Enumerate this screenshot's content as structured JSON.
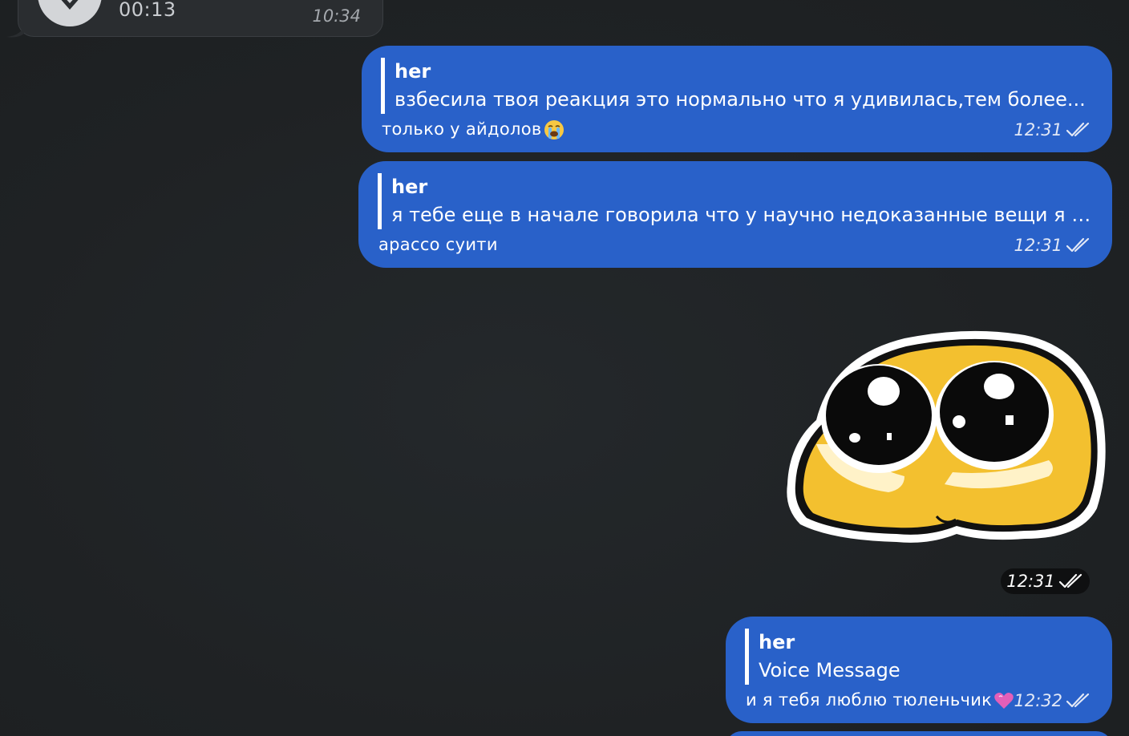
{
  "incoming_voice": {
    "duration": "00:13",
    "time": "10:34",
    "icon": "heart-icon"
  },
  "messages": [
    {
      "reply_author": "her",
      "reply_text": "взбесила твоя реакция   это нормально что я удивилась,тем более...",
      "text": "только у айдолов",
      "emoji": "loudly-crying-face-icon",
      "time": "12:31",
      "status_icon": "double-check-icon"
    },
    {
      "reply_author": "her",
      "reply_text": "я тебе еще в начале говорила что у научно недоказанные вещи я н...",
      "text": "арассо суити",
      "time": "12:31",
      "status_icon": "double-check-icon"
    },
    {
      "reply_author": "her",
      "reply_text": "Voice Message",
      "text": "и я тебя люблю тюленьчик",
      "emoji": "pink-heart-icon",
      "time": "12:32",
      "status_icon": "double-check-icon"
    }
  ],
  "sticker": {
    "description_icon": "cute-pleading-face-sticker-icon",
    "time": "12:31",
    "status_icon": "double-check-icon"
  },
  "colors": {
    "background": "#1f2224",
    "outgoing_bubble": "#2961c9",
    "incoming_bubble": "#2a2d30"
  }
}
